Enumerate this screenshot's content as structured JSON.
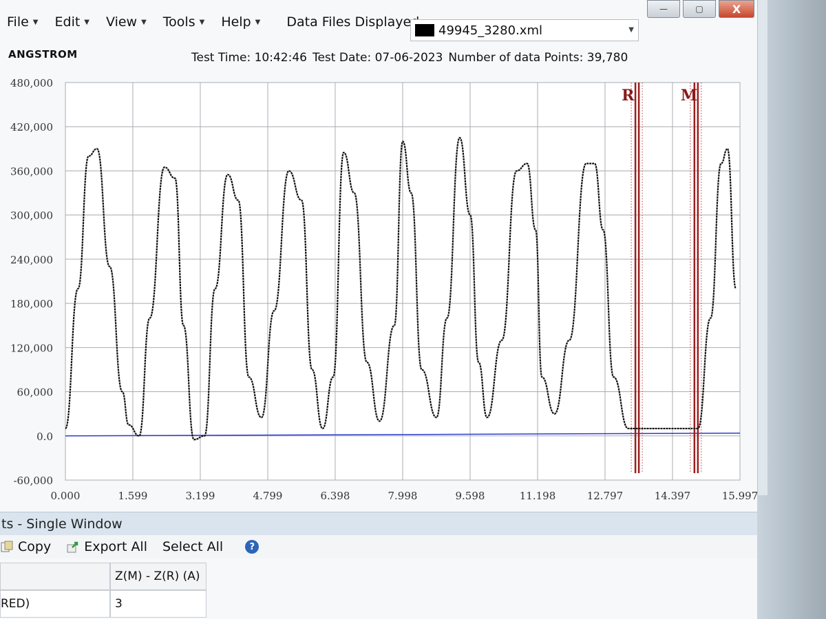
{
  "menus": [
    "File",
    "Edit",
    "View",
    "Tools",
    "Help"
  ],
  "files_label": "Data Files Displayed:",
  "selected_file": "49945_3280.xml",
  "window_controls": {
    "minimize": "—",
    "maximize": "▢",
    "close": "X"
  },
  "brand": "ANGSTROM",
  "test_info": {
    "time": "Test Time: 10:42:46",
    "date": "Test Date: 07-06-2023",
    "points": "Number of data Points: 39,780"
  },
  "chart_data": {
    "type": "line",
    "ylim": [
      -60000,
      480000
    ],
    "xlim": [
      0.0,
      15.997
    ],
    "y_ticks": [
      "480,000",
      "420,000",
      "360,000",
      "300,000",
      "240,000",
      "180,000",
      "120,000",
      "60,000",
      "0.0",
      "-60,000"
    ],
    "y_tick_values": [
      480000,
      420000,
      360000,
      300000,
      240000,
      180000,
      120000,
      60000,
      0,
      -60000
    ],
    "x_ticks": [
      "0.000",
      "1.599",
      "3.199",
      "4.799",
      "6.398",
      "7.998",
      "9.598",
      "11.198",
      "12.797",
      "14.397",
      "15.997"
    ],
    "x_tick_values": [
      0.0,
      1.599,
      3.199,
      4.799,
      6.398,
      7.998,
      9.598,
      11.198,
      12.797,
      14.397,
      15.997
    ],
    "grid": true,
    "series": [
      {
        "color": "#111111",
        "x": [
          0.0,
          0.3,
          0.55,
          0.75,
          1.05,
          1.35,
          1.5,
          1.75,
          2.0,
          2.35,
          2.6,
          2.8,
          3.05,
          3.3,
          3.55,
          3.85,
          4.1,
          4.35,
          4.65,
          4.95,
          5.3,
          5.6,
          5.85,
          6.1,
          6.35,
          6.6,
          6.85,
          7.15,
          7.45,
          7.8,
          8.0,
          8.2,
          8.45,
          8.8,
          9.05,
          9.35,
          9.6,
          9.8,
          10.0,
          10.35,
          10.7,
          10.95,
          11.15,
          11.3,
          11.6,
          11.95,
          12.35,
          12.55,
          12.75,
          13.0,
          13.35,
          13.55,
          13.8,
          14.5,
          15.0,
          15.3,
          15.55,
          15.7,
          15.9
        ],
        "y": [
          10000,
          200000,
          380000,
          390000,
          230000,
          60000,
          15000,
          0,
          160000,
          365000,
          350000,
          150000,
          -5000,
          0,
          200000,
          355000,
          320000,
          80000,
          25000,
          170000,
          360000,
          320000,
          90000,
          10000,
          80000,
          385000,
          330000,
          100000,
          20000,
          150000,
          400000,
          330000,
          90000,
          25000,
          160000,
          405000,
          300000,
          100000,
          25000,
          130000,
          360000,
          370000,
          280000,
          80000,
          30000,
          130000,
          370000,
          370000,
          280000,
          80000,
          10000,
          10000,
          10000,
          10000,
          10000,
          160000,
          370000,
          390000,
          200000
        ]
      }
    ],
    "baseline": {
      "y": 0,
      "color": "#2d3cc8"
    },
    "cursors": [
      {
        "label": "R",
        "x": 13.55
      },
      {
        "label": "M",
        "x": 14.95
      }
    ]
  },
  "panel": {
    "title": "ts - Single Window",
    "toolbar": {
      "copy": "Copy",
      "export": "Export All",
      "select": "Select All"
    },
    "table": {
      "header": "Z(M) - Z(R) (A)",
      "row_label": "RED)",
      "row_value": "3"
    }
  }
}
